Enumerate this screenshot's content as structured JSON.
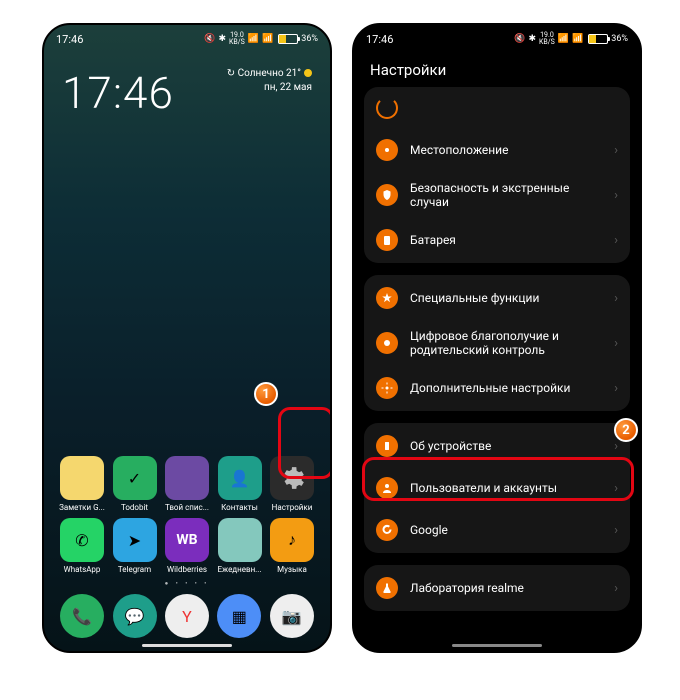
{
  "statusbar": {
    "time": "17:46",
    "net": "19.0",
    "netUnit": "KB/S",
    "batt": "36%"
  },
  "home": {
    "clock": "17:46",
    "weather": "Солнечно 21°",
    "date": "пн, 22 мая",
    "apps_row1": [
      {
        "label": "Заметки G..."
      },
      {
        "label": "Todobit"
      },
      {
        "label": "Твой спис..."
      },
      {
        "label": "Контакты"
      },
      {
        "label": "Настройки"
      }
    ],
    "apps_row2": [
      {
        "label": "WhatsApp"
      },
      {
        "label": "Telegram"
      },
      {
        "label": "Wildberries",
        "text": "WB"
      },
      {
        "label": "Ежедневн..."
      },
      {
        "label": "Музыка"
      }
    ]
  },
  "settings": {
    "title": "Настройки",
    "group1": [
      {
        "label": "Местоположение"
      },
      {
        "label": "Безопасность и экстренные случаи"
      },
      {
        "label": "Батарея"
      }
    ],
    "group2": [
      {
        "label": "Специальные функции"
      },
      {
        "label": "Цифровое благополучие и родительский контроль"
      },
      {
        "label": "Дополнительные настройки"
      }
    ],
    "group3": [
      {
        "label": "Об устройстве"
      },
      {
        "label": "Пользователи и аккаунты"
      },
      {
        "label": "Google"
      }
    ],
    "group4": [
      {
        "label": "Лаборатория realme"
      }
    ]
  },
  "annotations": {
    "step1": "1",
    "step2": "2"
  }
}
